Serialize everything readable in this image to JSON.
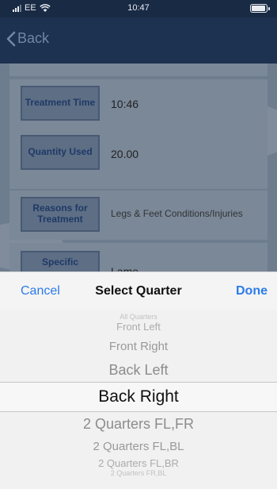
{
  "status_bar": {
    "carrier": "EE",
    "time": "10:47",
    "wifi_icon": "wifi-icon",
    "battery_icon": "battery-icon"
  },
  "nav": {
    "back_label": "Back",
    "back_icon": "chevron-left-icon"
  },
  "form": {
    "rows": [
      {
        "label": "Treatment Time",
        "value": "10:46"
      },
      {
        "label": "Quantity Used",
        "value": "20.00"
      },
      {
        "label": "Reasons for Treatment",
        "value": "Legs & Feet  Conditions/Injuries"
      },
      {
        "label": "Specific",
        "value": "Lame"
      }
    ]
  },
  "picker_toolbar": {
    "cancel_label": "Cancel",
    "title": "Select Quarter",
    "done_label": "Done"
  },
  "picker": {
    "options": [
      "All Quarters",
      "Front Left",
      "Front Right",
      "Back Left",
      "Back Right",
      "2 Quarters FL,FR",
      "2 Quarters FL,BL",
      "2 Quarters FL,BR",
      "2 Quarters FR,BL"
    ],
    "selected": "Back Right"
  },
  "colors": {
    "nav_background": "#1d3150",
    "accent": "#2b7bea",
    "label_background": "#5d6e85"
  }
}
